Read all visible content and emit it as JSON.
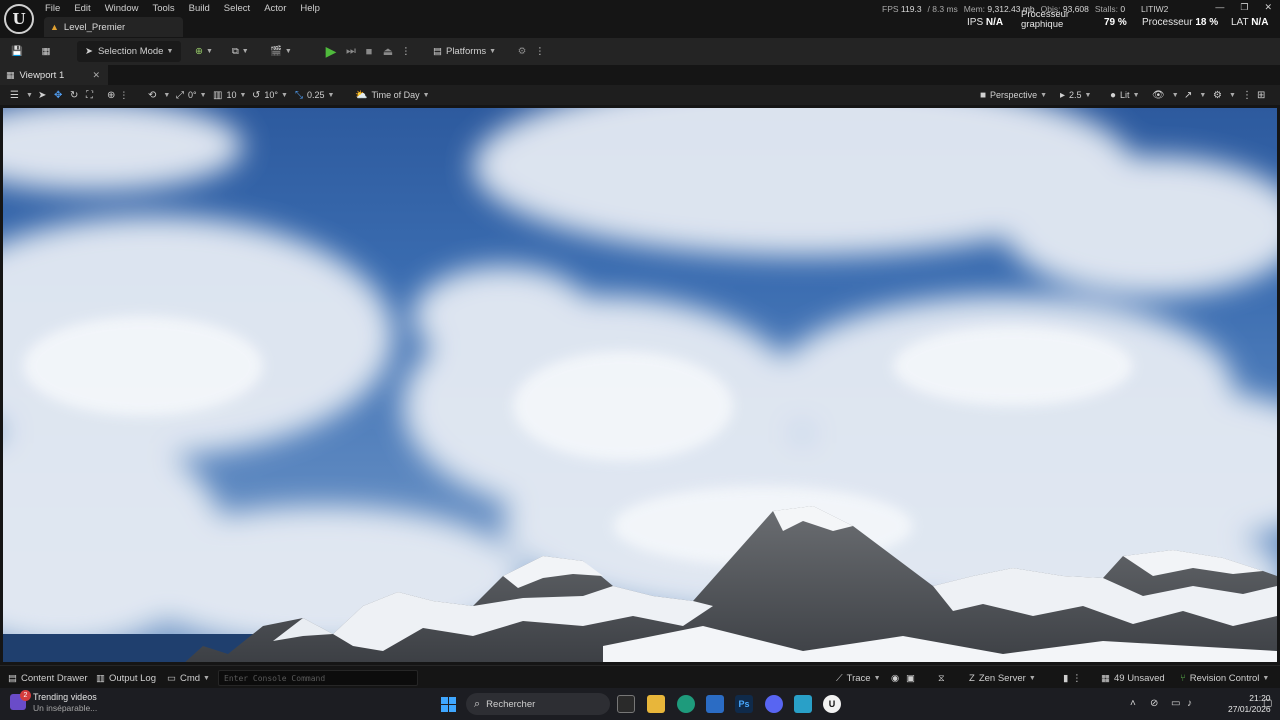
{
  "menu": [
    "File",
    "Edit",
    "Window",
    "Tools",
    "Build",
    "Select",
    "Actor",
    "Help"
  ],
  "level_tab": "Level_Premier",
  "stats": {
    "fps_label": "FPS",
    "fps": "119.3",
    "ms": "/ 8.3 ms",
    "mem_label": "Mem:",
    "mem": "9,312.43 mb",
    "objs_label": "Objs:",
    "objs": "93,608",
    "stalls_label": "Stalls:",
    "stalls": "0",
    "window_name": "LITIW2"
  },
  "perf": {
    "ips_label": "IPS",
    "ips": "N/A",
    "gpu_label_1": "Processeur",
    "gpu_label_2": "graphique",
    "gpu": "79 %",
    "cpu_label": "Processeur",
    "cpu": "18 %",
    "lat_label": "LAT",
    "lat": "N/A"
  },
  "toolbar": {
    "selection_mode": "Selection Mode",
    "platforms": "Platforms"
  },
  "viewport_tab": "Viewport 1",
  "viewport_toolbar": {
    "rotation_snap": "0°",
    "grid_snap": "10",
    "angle_snap": "10°",
    "scale_snap": "0.25",
    "time_of_day": "Time of Day",
    "perspective": "Perspective",
    "camera_speed": "2.5",
    "lit": "Lit"
  },
  "statusbar": {
    "content_drawer": "Content Drawer",
    "output_log": "Output Log",
    "cmd": "Cmd",
    "console_placeholder": "Enter Console Command",
    "trace": "Trace",
    "zen_server": "Zen Server",
    "unsaved": "49 Unsaved",
    "revision_control": "Revision Control"
  },
  "taskbar": {
    "trending_title": "Trending videos",
    "trending_sub": "Un inséparable...",
    "trending_badge": "2",
    "search_placeholder": "Rechercher",
    "time": "21:20",
    "date": "27/01/2026"
  },
  "colors": {
    "play_green": "#4fba3c",
    "windows_blue": "#3fa7ff",
    "sky_blue": "#3a6cb0"
  }
}
